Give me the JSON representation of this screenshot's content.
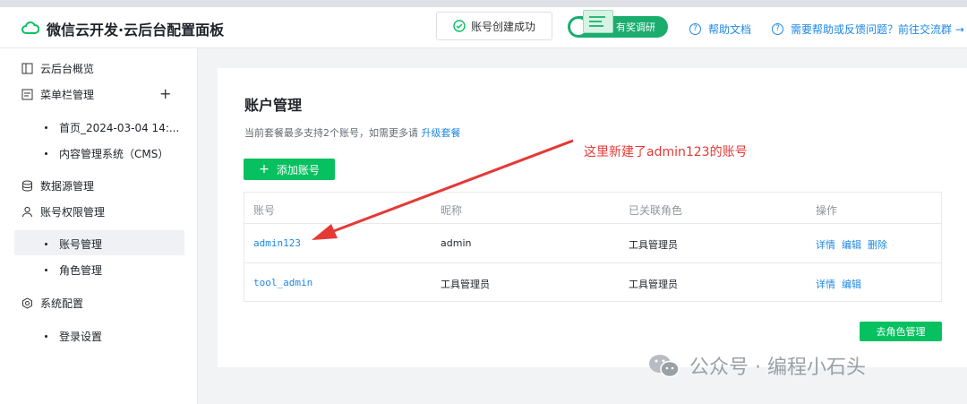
{
  "app": {
    "title": "微信云开发·云后台配置面板"
  },
  "header": {
    "toast": "账号创建成功",
    "survey_label": "有奖调研",
    "help_docs": "帮助文档",
    "feedback": "需要帮助或反馈问题？前往交流群 →"
  },
  "sidebar": {
    "overview": "云后台概览",
    "menu_mgmt": "菜单栏管理",
    "menu_sub1": "首页_2024-03-04 14:...",
    "menu_sub2": "内容管理系统（CMS）",
    "datasource": "数据源管理",
    "account_perm": "账号权限管理",
    "account_sub1": "账号管理",
    "account_sub2": "角色管理",
    "sys_config": "系统配置",
    "sys_sub1": "登录设置"
  },
  "main": {
    "title": "账户管理",
    "hint_text": "当前套餐最多支持2个账号，如需更多请",
    "hint_link": "升级套餐",
    "add_button": "添加账号",
    "columns": [
      "账号",
      "昵称",
      "已关联角色",
      "操作"
    ],
    "rows": [
      {
        "account": "admin123",
        "nickname": "admin",
        "role": "工具管理员",
        "actions": [
          "详情",
          "编辑",
          "删除"
        ]
      },
      {
        "account": "tool_admin",
        "nickname": "工具管理员",
        "role": "工具管理员",
        "actions": [
          "详情",
          "编辑"
        ]
      }
    ],
    "role_button": "去角色管理"
  },
  "annotation": {
    "text": "这里新建了admin123的账号"
  },
  "watermark": {
    "text": "公众号 · 编程小石头"
  },
  "colors": {
    "accent": "#07c160",
    "link": "#1e88e5",
    "annotation": "#e53935"
  }
}
